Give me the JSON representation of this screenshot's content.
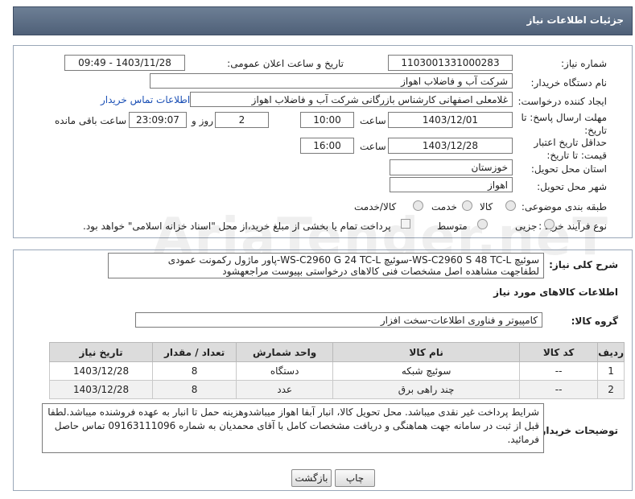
{
  "header": {
    "title": "جزئیات اطلاعات نیاز"
  },
  "form": {
    "need_number": {
      "label": "شماره نیاز:",
      "value": "1103001331000283"
    },
    "announce": {
      "label": "تاریخ و ساعت اعلان عمومی:",
      "value": "1403/11/28 - 09:49"
    },
    "buyer_org": {
      "label": "نام دستگاه خریدار:",
      "value": "شرکت آب و فاضلاب اهواز"
    },
    "requester": {
      "label": "ایجاد کننده درخواست:",
      "value": "غلامعلی اصفهانی کارشناس بازرگانی شرکت آب و فاضلاب اهواز",
      "contact_link": "اطلاعات تماس خریدار"
    },
    "deadline": {
      "label": "مهلت ارسال پاسخ: تا تاریخ:",
      "date": "1403/12/01",
      "time_label": "ساعت",
      "time": "10:00",
      "days": "2",
      "days_label": "روز و",
      "remaining": "23:09:07",
      "remaining_label": "ساعت باقی مانده"
    },
    "validity": {
      "label": "حداقل تاریخ اعتبار قیمت: تا تاریخ:",
      "date": "1403/12/28",
      "time_label": "ساعت",
      "time": "16:00"
    },
    "province": {
      "label": "استان محل تحویل:",
      "value": "خوزستان"
    },
    "city": {
      "label": "شهر محل تحویل:",
      "value": "اهواز"
    },
    "category": {
      "label": "طبقه بندی موضوعی:",
      "options": [
        "کالا",
        "خدمت",
        "کالا/خدمت"
      ],
      "selected": "کالا"
    },
    "process": {
      "label": "نوع فرآیند خرید :",
      "options": [
        "جزیی",
        "متوسط"
      ],
      "note": "پرداخت تمام یا بخشی از مبلغ خرید،از محل \"اسناد خزانه اسلامی\" خواهد بود."
    }
  },
  "description": {
    "label": "شرح کلی نیاز:",
    "line1": "سوئیچ WS-C2960 S 48 TC-L-سوئیچ WS-C2960 G 24 TC-L-پاور ماژول رکمونت عمودی",
    "line2": "لطفاجهت مشاهده اصل مشخصات فنی کالاهای درخواستی بپیوست مراجعهشود"
  },
  "goods": {
    "title": "اطلاعات کالاهای مورد نیاز",
    "group_label": "گروه کالا:",
    "group_value": "کامپیوتر و فناوری اطلاعات-سخت افزار",
    "columns": [
      "ردیف",
      "کد کالا",
      "نام کالا",
      "واحد شمارش",
      "تعداد / مقدار",
      "تاریخ نیاز"
    ],
    "rows": [
      [
        "1",
        "--",
        "سوئیچ شبکه",
        "دستگاه",
        "8",
        "1403/12/28"
      ],
      [
        "2",
        "--",
        "چند راهی برق",
        "عدد",
        "8",
        "1403/12/28"
      ]
    ]
  },
  "buyer_notes": {
    "label": "توضیحات خریدار:",
    "text": "شرایط پرداخت غیر نقدی میباشد. محل تحویل کالا، انبار آبفا اهواز میباشدوهزینه حمل تا انبار به عهده فروشنده میباشد.لطفا قبل از ثبت در سامانه جهت هماهنگی و دریافت مشخصات کامل با آقای  محمدیان به شماره 09163111096 تماس حاصل فرمائید."
  },
  "buttons": {
    "print": "چاپ",
    "back": "بازگشت"
  },
  "watermark": "AriaTender.neT"
}
